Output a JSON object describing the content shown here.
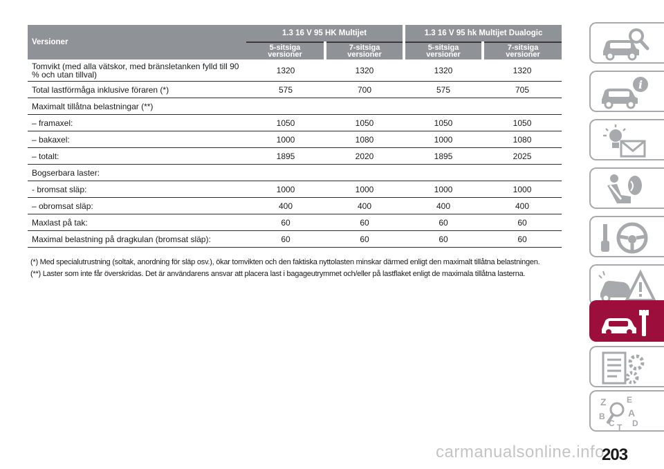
{
  "table": {
    "versions_label": "Versioner",
    "groups": [
      "1.3 16 V 95 HK Multijet",
      "1.3 16 V 95 hk Multijet Dualogic"
    ],
    "subheaders": [
      {
        "line1": "5-sitsiga",
        "line2": "versioner"
      },
      {
        "line1": "7-sitsiga",
        "line2": "versioner"
      },
      {
        "line1": "5-sitsiga",
        "line2": "versioner"
      },
      {
        "line1": "7-sitsiga",
        "line2": "versioner"
      }
    ],
    "rows": [
      {
        "label": "Tomvikt (med alla vätskor, med bränsletanken fylld till 90 % och utan tillval)",
        "values": [
          "1320",
          "1320",
          "1320",
          "1320"
        ]
      },
      {
        "label": "Total lastförmåga inklusive föraren (*)",
        "values": [
          "575",
          "700",
          "575",
          "705"
        ]
      },
      {
        "label": "Maximalt tillåtna belastningar (**)",
        "values": [
          "",
          "",
          "",
          ""
        ]
      },
      {
        "label": "– framaxel:",
        "values": [
          "1050",
          "1050",
          "1050",
          "1050"
        ]
      },
      {
        "label": "– bakaxel:",
        "values": [
          "1000",
          "1080",
          "1000",
          "1080"
        ]
      },
      {
        "label": "– totalt:",
        "values": [
          "1895",
          "2020",
          "1895",
          "2025"
        ]
      },
      {
        "label": "Bogserbara laster:",
        "values": [
          "",
          "",
          "",
          ""
        ]
      },
      {
        "label": "- bromsat släp:",
        "values": [
          "1000",
          "1000",
          "1000",
          "1000"
        ]
      },
      {
        "label": "– obromsat släp:",
        "values": [
          "400",
          "400",
          "400",
          "400"
        ]
      },
      {
        "label": "Maxlast på tak:",
        "values": [
          "60",
          "60",
          "60",
          "60"
        ]
      },
      {
        "label": "Maximal belastning på dragkulan (bromsat släp):",
        "values": [
          "60",
          "60",
          "60",
          "60"
        ]
      }
    ]
  },
  "notes": [
    "(*) Med specialutrustning (soltak, anordning för släp osv.), ökar tomvikten och den faktiska nyttolasten minskar därmed enligt den maximalt tillåtna belastningen.",
    "(**) Laster som inte får överskridas. Det är användarens ansvar att placera last i bagageutrymmet och/eller på lastflaket enligt de maximala tillåtna lasterna."
  ],
  "sidebar": {
    "tabs": [
      {
        "icon": "car-magnifier-icon",
        "active": false
      },
      {
        "icon": "car-info-icon",
        "active": false
      },
      {
        "icon": "warning-light-message-icon",
        "active": false
      },
      {
        "icon": "seat-airbag-icon",
        "active": false
      },
      {
        "icon": "key-steering-wheel-icon",
        "active": false
      },
      {
        "icon": "car-warning-triangle-icon",
        "active": false
      },
      {
        "icon": "car-wrench-icon",
        "active": true
      },
      {
        "icon": "checklist-gears-icon",
        "active": false
      },
      {
        "icon": "alphabet-index-icon",
        "active": false
      }
    ],
    "letters": [
      "Z",
      "E",
      "B",
      "A",
      "C",
      "D",
      "T"
    ],
    "active_color": "#9c0f3c",
    "border_color": "#a7a9ac"
  },
  "page_number": "203",
  "watermark": "carmanualsonline.info"
}
